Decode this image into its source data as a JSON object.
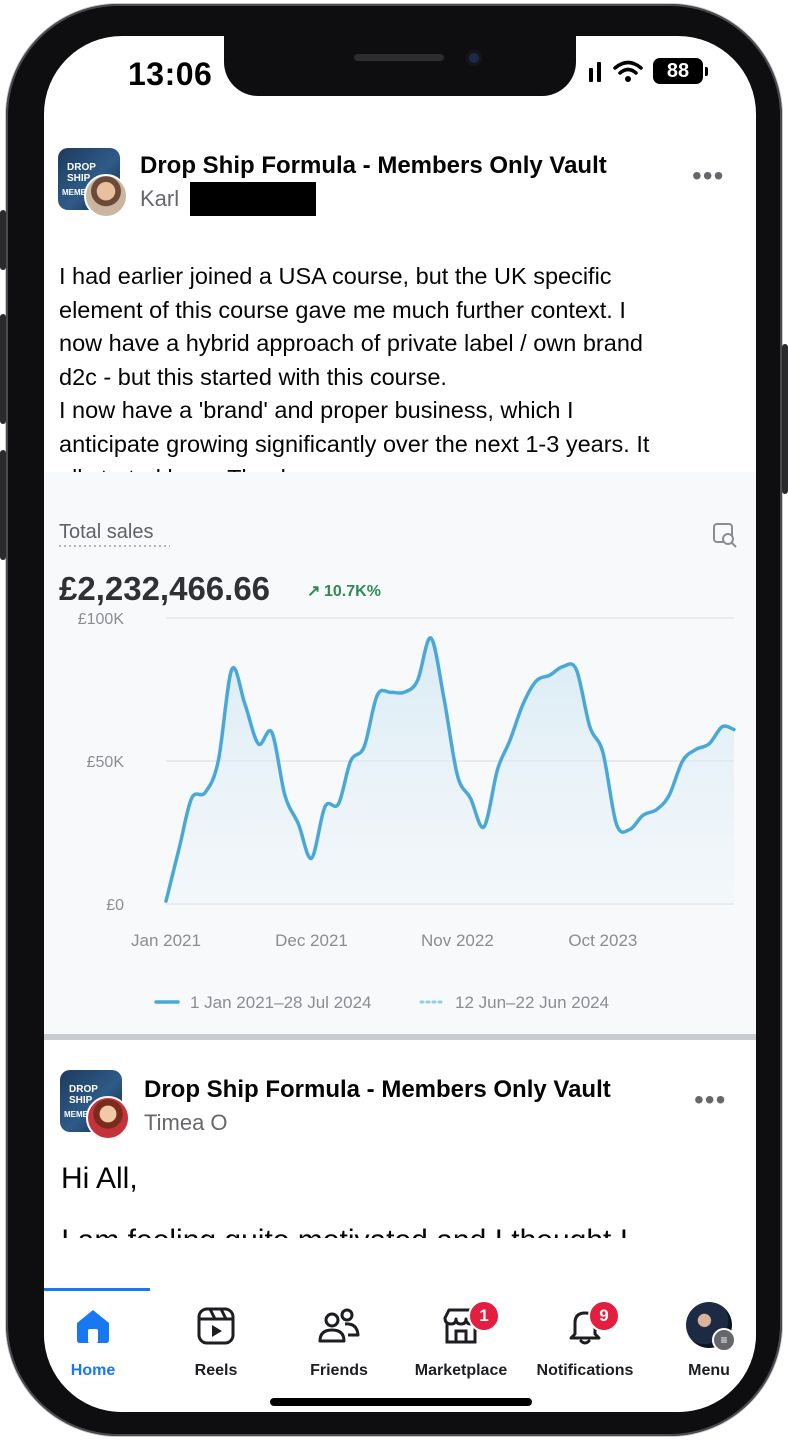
{
  "status_bar": {
    "time": "13:06",
    "battery": "88"
  },
  "post1": {
    "group": "Drop Ship Formula - Members Only Vault",
    "author": "Karl",
    "avatar_text_1": "DROP SHIP",
    "avatar_text_2": "MEMBERS",
    "body": "I had earlier joined a USA course, but the UK specific\nelement of this course gave me much further context. I\nnow have a hybrid approach of private label / own brand\nd2c - but this started with this course.\nI now have a 'brand' and proper business, which I\nanticipate growing significantly over the next 1-3 years. It\nall started here. Thank you."
  },
  "chart_data": {
    "type": "area",
    "title": "Total sales",
    "total": "£2,232,466.66",
    "change": "10.7K%",
    "ylim": [
      0,
      100000
    ],
    "y_ticks": [
      "£0",
      "£50K",
      "£100K"
    ],
    "x_ticks": [
      "Jan 2021",
      "Dec 2021",
      "Nov 2022",
      "Oct 2023"
    ],
    "x_range": [
      "2021-01-01",
      "2024-07-28"
    ],
    "legend": [
      "1 Jan 2021–28 Jul 2024",
      "12 Jun–22 Jun 2024"
    ],
    "series": [
      {
        "name": "1 Jan 2021–28 Jul 2024",
        "x": [
          "2021-01-01",
          "2021-02-01",
          "2021-03-01",
          "2021-04-01",
          "2021-05-01",
          "2021-06-01",
          "2021-07-01",
          "2021-08-01",
          "2021-09-01",
          "2021-10-01",
          "2021-11-01",
          "2021-12-01",
          "2022-01-01",
          "2022-02-01",
          "2022-03-01",
          "2022-04-01",
          "2022-05-01",
          "2022-06-01",
          "2022-07-01",
          "2022-08-01",
          "2022-09-01",
          "2022-10-01",
          "2022-11-01",
          "2022-12-01",
          "2023-01-01",
          "2023-02-01",
          "2023-03-01",
          "2023-04-01",
          "2023-05-01",
          "2023-06-01",
          "2023-07-01",
          "2023-08-01",
          "2023-09-01",
          "2023-10-01",
          "2023-11-01",
          "2023-12-01",
          "2024-01-01",
          "2024-02-01",
          "2024-03-01",
          "2024-04-01",
          "2024-05-01",
          "2024-06-01",
          "2024-07-01",
          "2024-07-28"
        ],
        "values": [
          1000,
          20000,
          37000,
          39000,
          50000,
          82000,
          70000,
          56000,
          60000,
          38000,
          28000,
          16000,
          34000,
          35000,
          50000,
          55000,
          73000,
          74000,
          74000,
          78000,
          93000,
          72000,
          45000,
          37000,
          27000,
          47000,
          57000,
          70000,
          78000,
          80000,
          83000,
          82000,
          62000,
          53000,
          28000,
          26000,
          31000,
          33000,
          38000,
          50000,
          54000,
          56000,
          62000,
          61000
        ]
      }
    ]
  },
  "post2": {
    "group": "Drop Ship Formula - Members Only Vault",
    "author": "Timea O",
    "greeting": "Hi All,",
    "preview": "I am feeling quite motivated and I thought I"
  },
  "nav": [
    {
      "label": "Home",
      "icon": "home-icon",
      "active": true
    },
    {
      "label": "Reels",
      "icon": "reels-icon"
    },
    {
      "label": "Friends",
      "icon": "friends-icon"
    },
    {
      "label": "Marketplace",
      "icon": "marketplace-icon",
      "badge": "1"
    },
    {
      "label": "Notifications",
      "icon": "bell-icon",
      "badge": "9"
    },
    {
      "label": "Menu",
      "icon": "profile-avatar"
    }
  ],
  "colors": {
    "accent": "#1877f2",
    "badge": "#e41e3f",
    "line": "#4aa8d8",
    "positive": "#2e8b57"
  }
}
